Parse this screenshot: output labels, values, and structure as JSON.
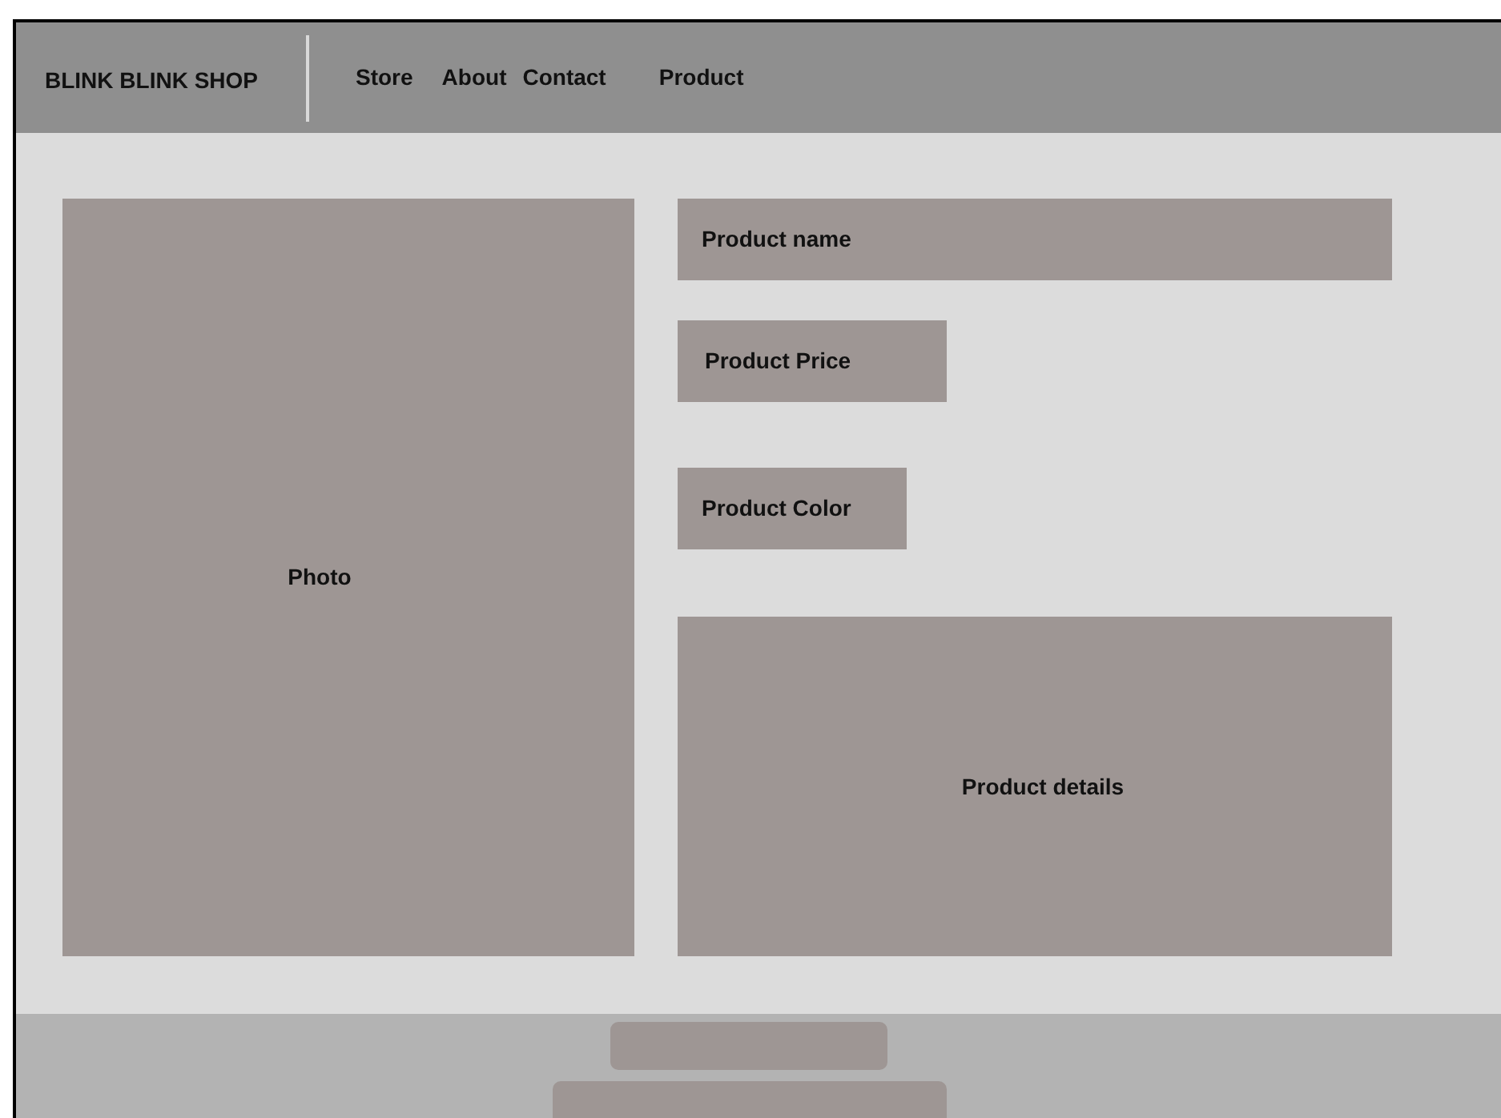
{
  "header": {
    "brand": "BLINK BLINK SHOP",
    "nav": [
      "Store",
      "About",
      "Contact",
      "Product"
    ]
  },
  "photo": {
    "label": "Photo"
  },
  "product": {
    "name_label": "Product name",
    "price_label": "Product Price",
    "color_label": "Product Color",
    "details_label": "Product details"
  }
}
